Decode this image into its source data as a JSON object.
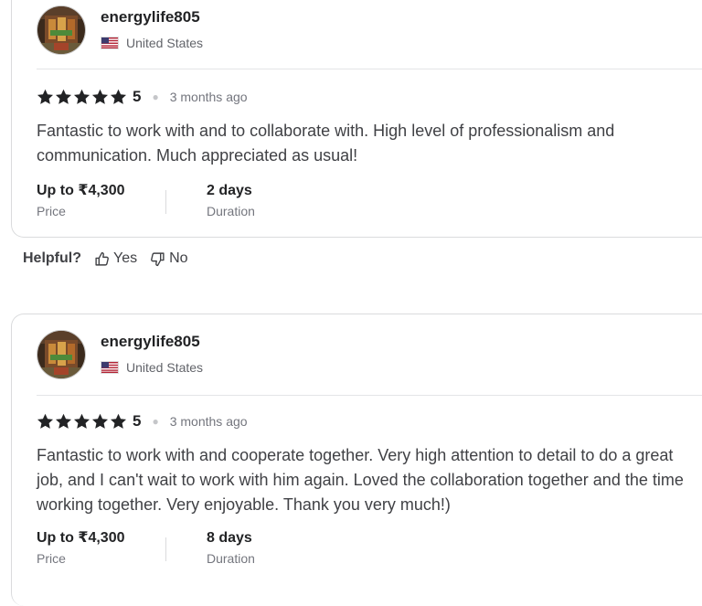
{
  "reviews": [
    {
      "username": "energylife805",
      "country": "United States",
      "rating": "5",
      "time": "3 months ago",
      "text": "Fantastic to work with and to collaborate with. High level of professionalism and communication. Much appreciated as usual!",
      "price_value": "Up to ₹4,300",
      "price_label": "Price",
      "duration_value": "2 days",
      "duration_label": "Duration"
    },
    {
      "username": "energylife805",
      "country": "United States",
      "rating": "5",
      "time": "3 months ago",
      "text": "Fantastic to work with and cooperate together. Very high attention to detail to do a great job, and I can't wait to work with him again. Loved the collaboration together and the time working together. Very enjoyable. Thank you very much!)",
      "price_value": "Up to ₹4,300",
      "price_label": "Price",
      "duration_value": "8 days",
      "duration_label": "Duration"
    }
  ],
  "helpful": {
    "label": "Helpful?",
    "yes": "Yes",
    "no": "No"
  },
  "icons": {
    "star": "star-icon",
    "flag": "us-flag-icon",
    "thumbs_up": "thumbs-up-icon",
    "thumbs_down": "thumbs-down-icon"
  },
  "colors": {
    "star": "#222325",
    "text": "#404145",
    "muted": "#74767e",
    "border": "#dadbdd"
  }
}
